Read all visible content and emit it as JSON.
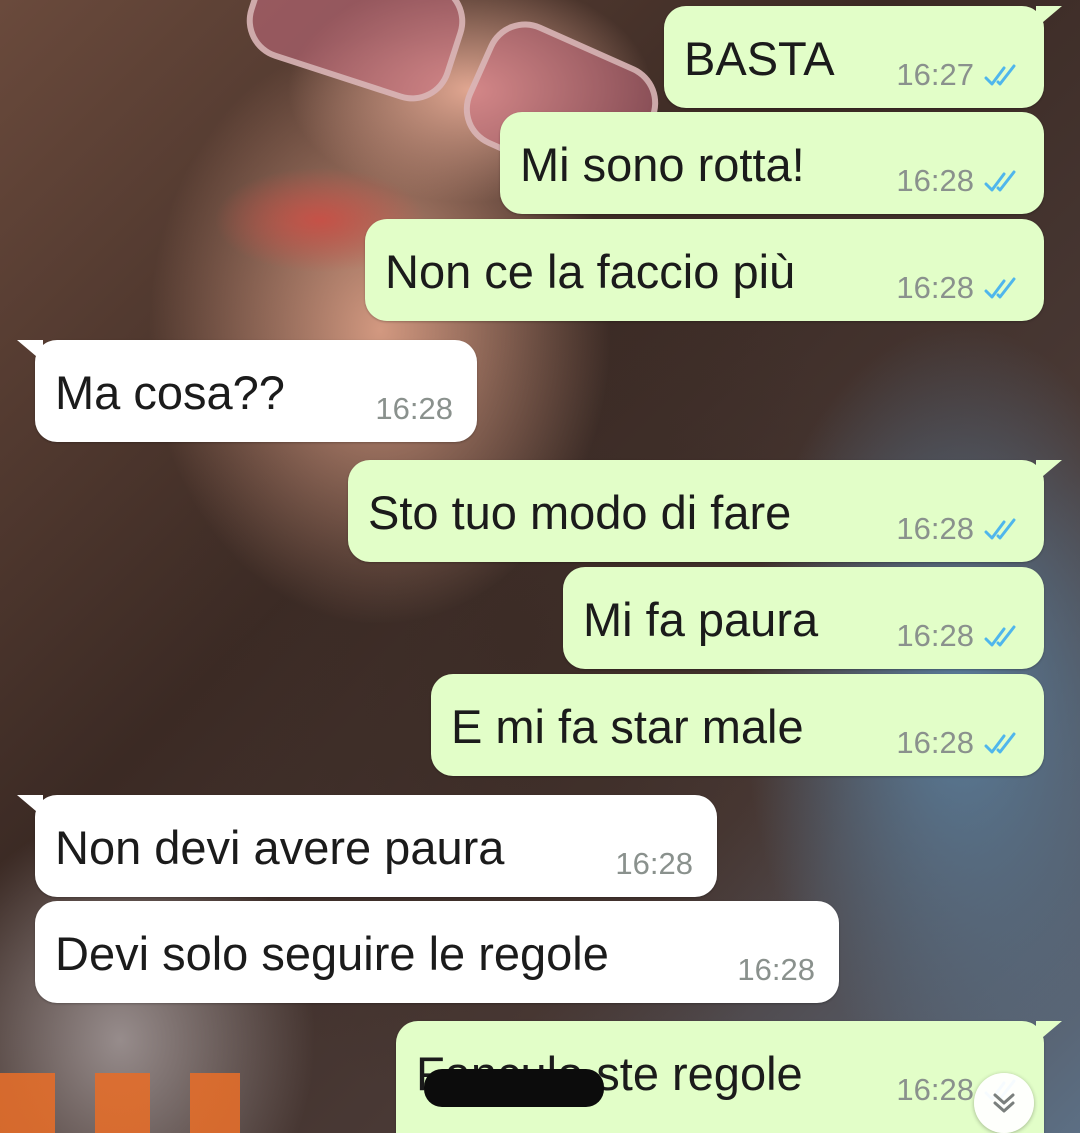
{
  "conversation": {
    "messages": [
      {
        "text": "BASTA",
        "time": "16:27"
      },
      {
        "text": "Mi sono rotta!",
        "time": "16:28"
      },
      {
        "text": "Non ce la faccio più",
        "time": "16:28"
      },
      {
        "text": "Ma cosa??",
        "time": "16:28"
      },
      {
        "text": "Sto tuo modo di fare",
        "time": "16:28"
      },
      {
        "text": "Mi fa paura",
        "time": "16:28"
      },
      {
        "text": "E mi fa star male",
        "time": "16:28"
      },
      {
        "text": "Non devi avere paura",
        "time": "16:28"
      },
      {
        "text": "Devi solo seguire le regole",
        "time": "16:28"
      },
      {
        "text": "Fanculo ste regole",
        "time": "16:28"
      }
    ]
  },
  "colors": {
    "outgoing_bubble": "#e2fec8",
    "incoming_bubble": "#ffffff",
    "read_ticks": "#4fb6ec",
    "timestamp": "#8a918d"
  },
  "icons": {
    "read_receipt": "double-check-icon",
    "scroll_down": "double-chevron-down-icon"
  }
}
